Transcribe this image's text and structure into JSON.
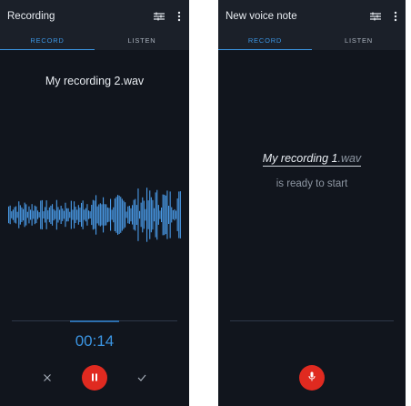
{
  "left_screen": {
    "appbar": {
      "title": "Recording",
      "settings_icon": "tune-icon",
      "menu_icon": "more-vert-icon"
    },
    "tabs": [
      {
        "label": "RECORD",
        "active": true
      },
      {
        "label": "LISTEN",
        "active": false
      }
    ],
    "filename": "My recording 2.wav",
    "timer": "00:14",
    "progress_fraction": 0.3,
    "controls": {
      "cancel_icon": "close-icon",
      "pause_icon": "pause-icon",
      "save_icon": "check-icon"
    },
    "colors": {
      "accent": "#3b95e3",
      "record": "#e02a20",
      "waveform": "#4a9be8"
    }
  },
  "right_screen": {
    "appbar": {
      "title": "New voice note",
      "settings_icon": "tune-icon",
      "menu_icon": "more-vert-icon"
    },
    "tabs": [
      {
        "label": "RECORD",
        "active": true
      },
      {
        "label": "LISTEN",
        "active": false
      }
    ],
    "ready_name": "My recording 1",
    "ready_ext": ".wav",
    "ready_text": "is ready to start",
    "controls": {
      "record_icon": "mic-icon"
    }
  }
}
